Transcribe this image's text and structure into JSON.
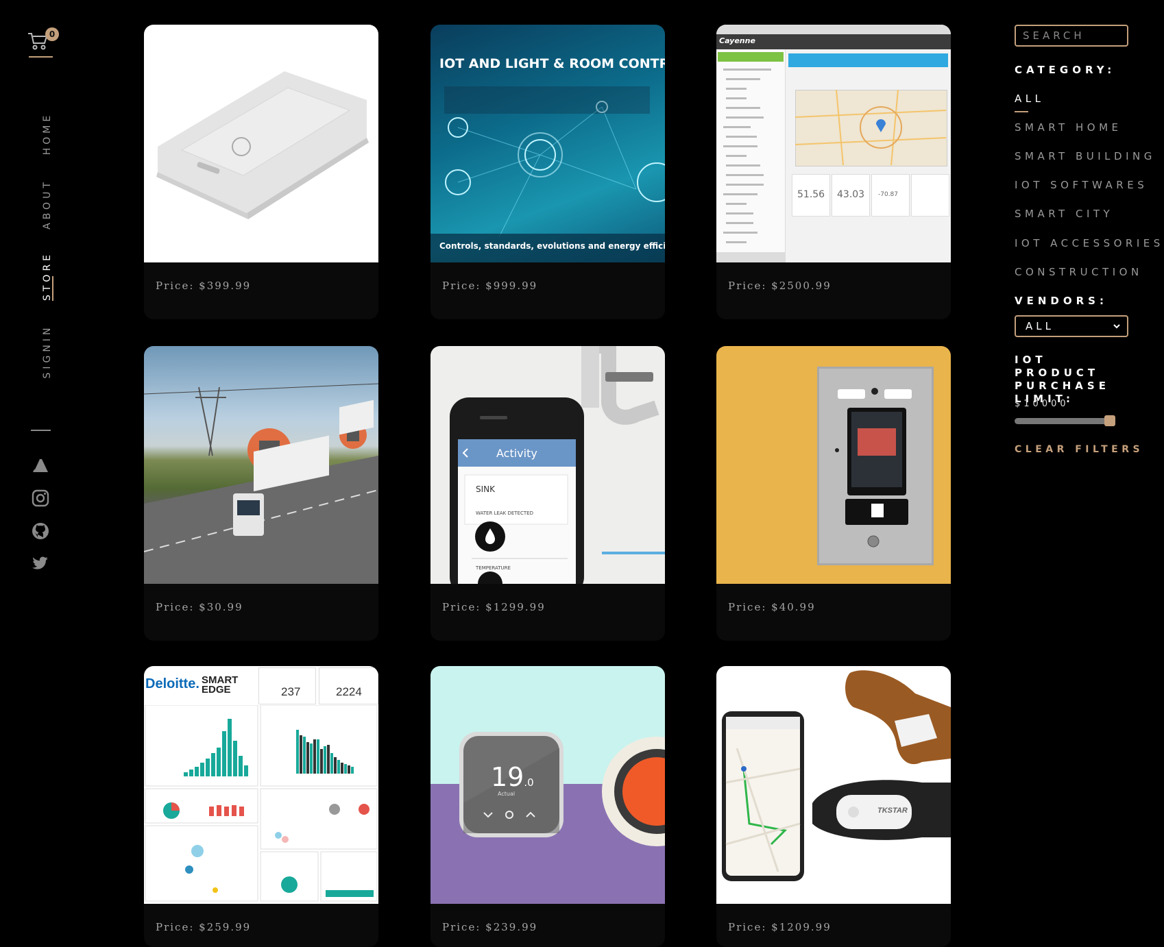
{
  "cart": {
    "count": "0"
  },
  "nav": {
    "home": "HOME",
    "about": "ABOUT",
    "store": "STORE",
    "signin": "SIGNIN"
  },
  "social": [
    "brand-logo-icon",
    "instagram-icon",
    "github-icon",
    "twitter-icon"
  ],
  "images": {
    "banner_title": "IOT AND LIGHT & ROOM CONTRO",
    "banner_caption": "Controls, standards, evolutions and energy efficiency",
    "dashboard_brand": "Cayenne",
    "dashboard_values": [
      "51.56",
      "43.03",
      "-70.87"
    ],
    "phone_title": "Activity",
    "phone_sink": "SINK",
    "phone_alert": "WATER LEAK DETECTED",
    "phone_temp": "TEMPERATURE",
    "deloitte_brand": "Deloitte.",
    "smartedge": "SMART EDGE",
    "deloitte_vals": [
      "237",
      "2224"
    ],
    "thermo_temp": "19",
    "thermo_decimal": ".0",
    "thermo_label": "Actual",
    "tracker_brand": "TKSTAR"
  },
  "products": [
    {
      "price": "Price: $399.99"
    },
    {
      "price": "Price: $999.99"
    },
    {
      "price": "Price: $2500.99"
    },
    {
      "price": "Price: $30.99"
    },
    {
      "price": "Price: $1299.99"
    },
    {
      "price": "Price: $40.99"
    },
    {
      "price": "Price: $259.99"
    },
    {
      "price": "Price: $239.99"
    },
    {
      "price": "Price: $1209.99"
    }
  ],
  "filters": {
    "search_placeholder": "SEARCH",
    "category_label": "CATEGORY:",
    "categories": [
      "ALL",
      "SMART HOME",
      "SMART BUILDING",
      "IOT SOFTWARES",
      "SMART CITY",
      "IOT ACCESSORIES",
      "CONSTRUCTION"
    ],
    "vendors_label": "VENDORS:",
    "vendor_selected": "ALL",
    "limit_label": "IOT PRODUCT PURCHASE LIMIT:",
    "limit_value": "$10000",
    "limit_fraction": 0.96,
    "clear": "CLEAR FILTERS"
  },
  "colors": {
    "accent": "#c5a07c",
    "background": "#000000",
    "card": "#0a0a0a"
  }
}
